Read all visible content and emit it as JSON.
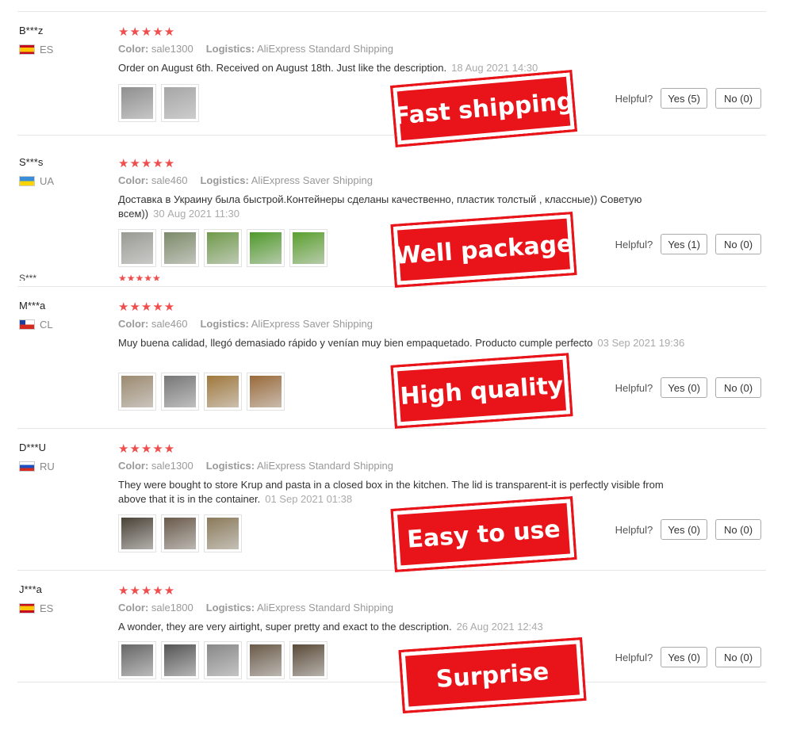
{
  "helpful_label": "Helpful?",
  "color_label": "Color:",
  "logistics_label": "Logistics:",
  "stars": "★★★★★",
  "partial_user": "S***",
  "partial_stars": "★★★★★",
  "reviews": [
    {
      "user": "B***z",
      "country": "ES",
      "flag": "es",
      "color": "sale1300",
      "logistics": "AliExpress Standard Shipping",
      "text": "Order on August 6th. Received on August 18th. Just like the description.",
      "date": "18 Aug 2021 14:30",
      "thumbs": [
        "#8f8f8f",
        "#a6a6a6"
      ],
      "yes": "Yes (5)",
      "no": "No (0)",
      "stamp": "Fast shipping"
    },
    {
      "user": "S***s",
      "country": "UA",
      "flag": "ua",
      "color": "sale460",
      "logistics": "AliExpress Saver Shipping",
      "text": "Доставка в Украину была быстрой.Контейнеры сделаны качественно, пластик толстый , классные)) Советую всем))",
      "date": "30 Aug 2021 11:30",
      "thumbs": [
        "#9a9a94",
        "#7d8a6a",
        "#6f9a4a",
        "#4f9a2a",
        "#5aa02e"
      ],
      "yes": "Yes (1)",
      "no": "No (0)",
      "stamp": "Well package"
    },
    {
      "user": "M***a",
      "country": "CL",
      "flag": "cl",
      "color": "sale460",
      "logistics": "AliExpress Saver Shipping",
      "text": "Muy buena calidad, llegó demasiado rápido y venían muy bien empaquetado. Producto cumple perfecto",
      "date": "03 Sep 2021 19:36",
      "thumbs": [
        "#9c8a70",
        "#777777",
        "#a0783c",
        "#9a6a3a"
      ],
      "yes": "Yes (0)",
      "no": "No (0)",
      "stamp": "High quality"
    },
    {
      "user": "D***U",
      "country": "RU",
      "flag": "ru",
      "color": "sale1300",
      "logistics": "AliExpress Standard Shipping",
      "text": "They were bought to store Krup and pasta in a closed box in the kitchen. The lid is transparent-it is perfectly visible from above that it is in the container.",
      "date": "01 Sep 2021 01:38",
      "thumbs": [
        "#4a4236",
        "#6a5a4a",
        "#8a7a5a"
      ],
      "yes": "Yes (0)",
      "no": "No (0)",
      "stamp": "Easy to use"
    },
    {
      "user": "J***a",
      "country": "ES",
      "flag": "es",
      "color": "sale1800",
      "logistics": "AliExpress Standard Shipping",
      "text": "A wonder, they are very airtight, super pretty and exact to the description.",
      "date": "26 Aug 2021 12:43",
      "thumbs": [
        "#666666",
        "#555555",
        "#888888",
        "#6a5a48",
        "#5a4a38"
      ],
      "yes": "Yes (0)",
      "no": "No (0)",
      "stamp": "Surprise"
    }
  ]
}
